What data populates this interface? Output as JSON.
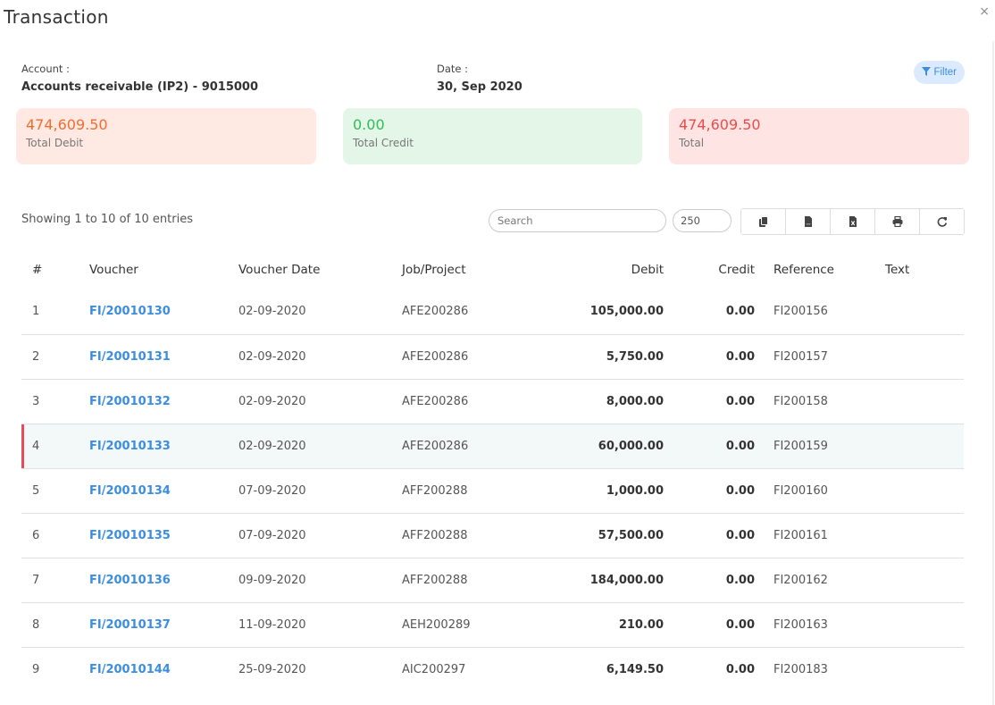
{
  "modal": {
    "title": "Transaction",
    "close_label": "×"
  },
  "info": {
    "account_label": "Account :",
    "account_value": "Accounts receivable (IP2) - 9015000",
    "date_label": "Date :",
    "date_value": "30, Sep 2020"
  },
  "filter_button": {
    "label": "Filter",
    "icon": "filter-icon"
  },
  "summary": {
    "debit": {
      "value": "474,609.50",
      "label": "Total Debit",
      "color": "#f26d2d",
      "bg": "#ffe9e2"
    },
    "credit": {
      "value": "0.00",
      "label": "Total Credit",
      "color": "#2fbd55",
      "bg": "#e4f6e8"
    },
    "total": {
      "value": "474,609.50",
      "label": "Total",
      "color": "#f04a4a",
      "bg": "#ffe4e4"
    }
  },
  "table_controls": {
    "showing_text": "Showing 1 to 10 of 10 entries",
    "search_placeholder": "Search",
    "search_value": "",
    "page_size": "250",
    "toolbar": [
      {
        "name": "copy",
        "icon": "copy-icon"
      },
      {
        "name": "csv",
        "icon": "csv-file-icon"
      },
      {
        "name": "excel",
        "icon": "excel-file-icon"
      },
      {
        "name": "print",
        "icon": "print-icon"
      },
      {
        "name": "refresh",
        "icon": "refresh-icon"
      }
    ]
  },
  "table": {
    "columns": [
      "#",
      "Voucher",
      "Voucher Date",
      "Job/Project",
      "Debit",
      "Credit",
      "Reference",
      "Text"
    ],
    "highlighted_row_index": 3,
    "accent_color": "#3b8de0",
    "highlight_border_color": "#e94a5b",
    "rows": [
      {
        "num": "1",
        "voucher": "FI/20010130",
        "date": "02-09-2020",
        "job": "AFE200286",
        "debit": "105,000.00",
        "credit": "0.00",
        "reference": "FI200156",
        "text": ""
      },
      {
        "num": "2",
        "voucher": "FI/20010131",
        "date": "02-09-2020",
        "job": "AFE200286",
        "debit": "5,750.00",
        "credit": "0.00",
        "reference": "FI200157",
        "text": ""
      },
      {
        "num": "3",
        "voucher": "FI/20010132",
        "date": "02-09-2020",
        "job": "AFE200286",
        "debit": "8,000.00",
        "credit": "0.00",
        "reference": "FI200158",
        "text": ""
      },
      {
        "num": "4",
        "voucher": "FI/20010133",
        "date": "02-09-2020",
        "job": "AFE200286",
        "debit": "60,000.00",
        "credit": "0.00",
        "reference": "FI200159",
        "text": ""
      },
      {
        "num": "5",
        "voucher": "FI/20010134",
        "date": "07-09-2020",
        "job": "AFF200288",
        "debit": "1,000.00",
        "credit": "0.00",
        "reference": "FI200160",
        "text": ""
      },
      {
        "num": "6",
        "voucher": "FI/20010135",
        "date": "07-09-2020",
        "job": "AFF200288",
        "debit": "57,500.00",
        "credit": "0.00",
        "reference": "FI200161",
        "text": ""
      },
      {
        "num": "7",
        "voucher": "FI/20010136",
        "date": "09-09-2020",
        "job": "AFF200288",
        "debit": "184,000.00",
        "credit": "0.00",
        "reference": "FI200162",
        "text": ""
      },
      {
        "num": "8",
        "voucher": "FI/20010137",
        "date": "11-09-2020",
        "job": "AEH200289",
        "debit": "210.00",
        "credit": "0.00",
        "reference": "FI200163",
        "text": ""
      },
      {
        "num": "9",
        "voucher": "FI/20010144",
        "date": "25-09-2020",
        "job": "AIC200297",
        "debit": "6,149.50",
        "credit": "0.00",
        "reference": "FI200183",
        "text": ""
      }
    ]
  }
}
